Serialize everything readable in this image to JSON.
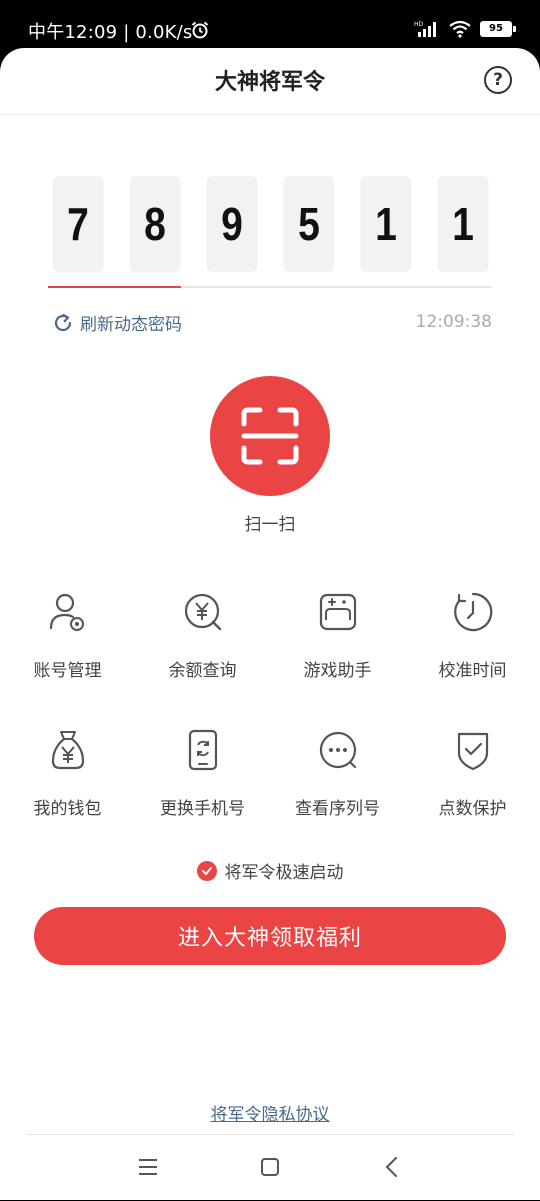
{
  "status_bar": {
    "time": "中午12:09",
    "speed": "0.0K/s",
    "battery": "95"
  },
  "header": {
    "title": "大神将军令",
    "help": "?"
  },
  "otp": {
    "digits": [
      "7",
      "8",
      "9",
      "5",
      "1",
      "1"
    ],
    "refresh_label": "刷新动态密码",
    "time": "12:09:38",
    "progress_fraction": 0.3
  },
  "scan": {
    "label": "扫一扫"
  },
  "grid": {
    "items": [
      {
        "label": "账号管理",
        "icon": "account-settings-icon"
      },
      {
        "label": "余额查询",
        "icon": "balance-search-icon"
      },
      {
        "label": "游戏助手",
        "icon": "gamepad-icon"
      },
      {
        "label": "校准时间",
        "icon": "clock-icon"
      },
      {
        "label": "我的钱包",
        "icon": "money-bag-icon"
      },
      {
        "label": "更换手机号",
        "icon": "phone-change-icon"
      },
      {
        "label": "查看序列号",
        "icon": "chat-dots-icon"
      },
      {
        "label": "点数保护",
        "icon": "shield-check-icon"
      }
    ]
  },
  "fast_start": {
    "label": "将军令极速启动",
    "checked": true
  },
  "main_button": {
    "label": "进入大神领取福利"
  },
  "footer": {
    "privacy_link": "将军令隐私协议"
  },
  "colors": {
    "accent": "#ea4444",
    "link": "#4a6a8a"
  }
}
